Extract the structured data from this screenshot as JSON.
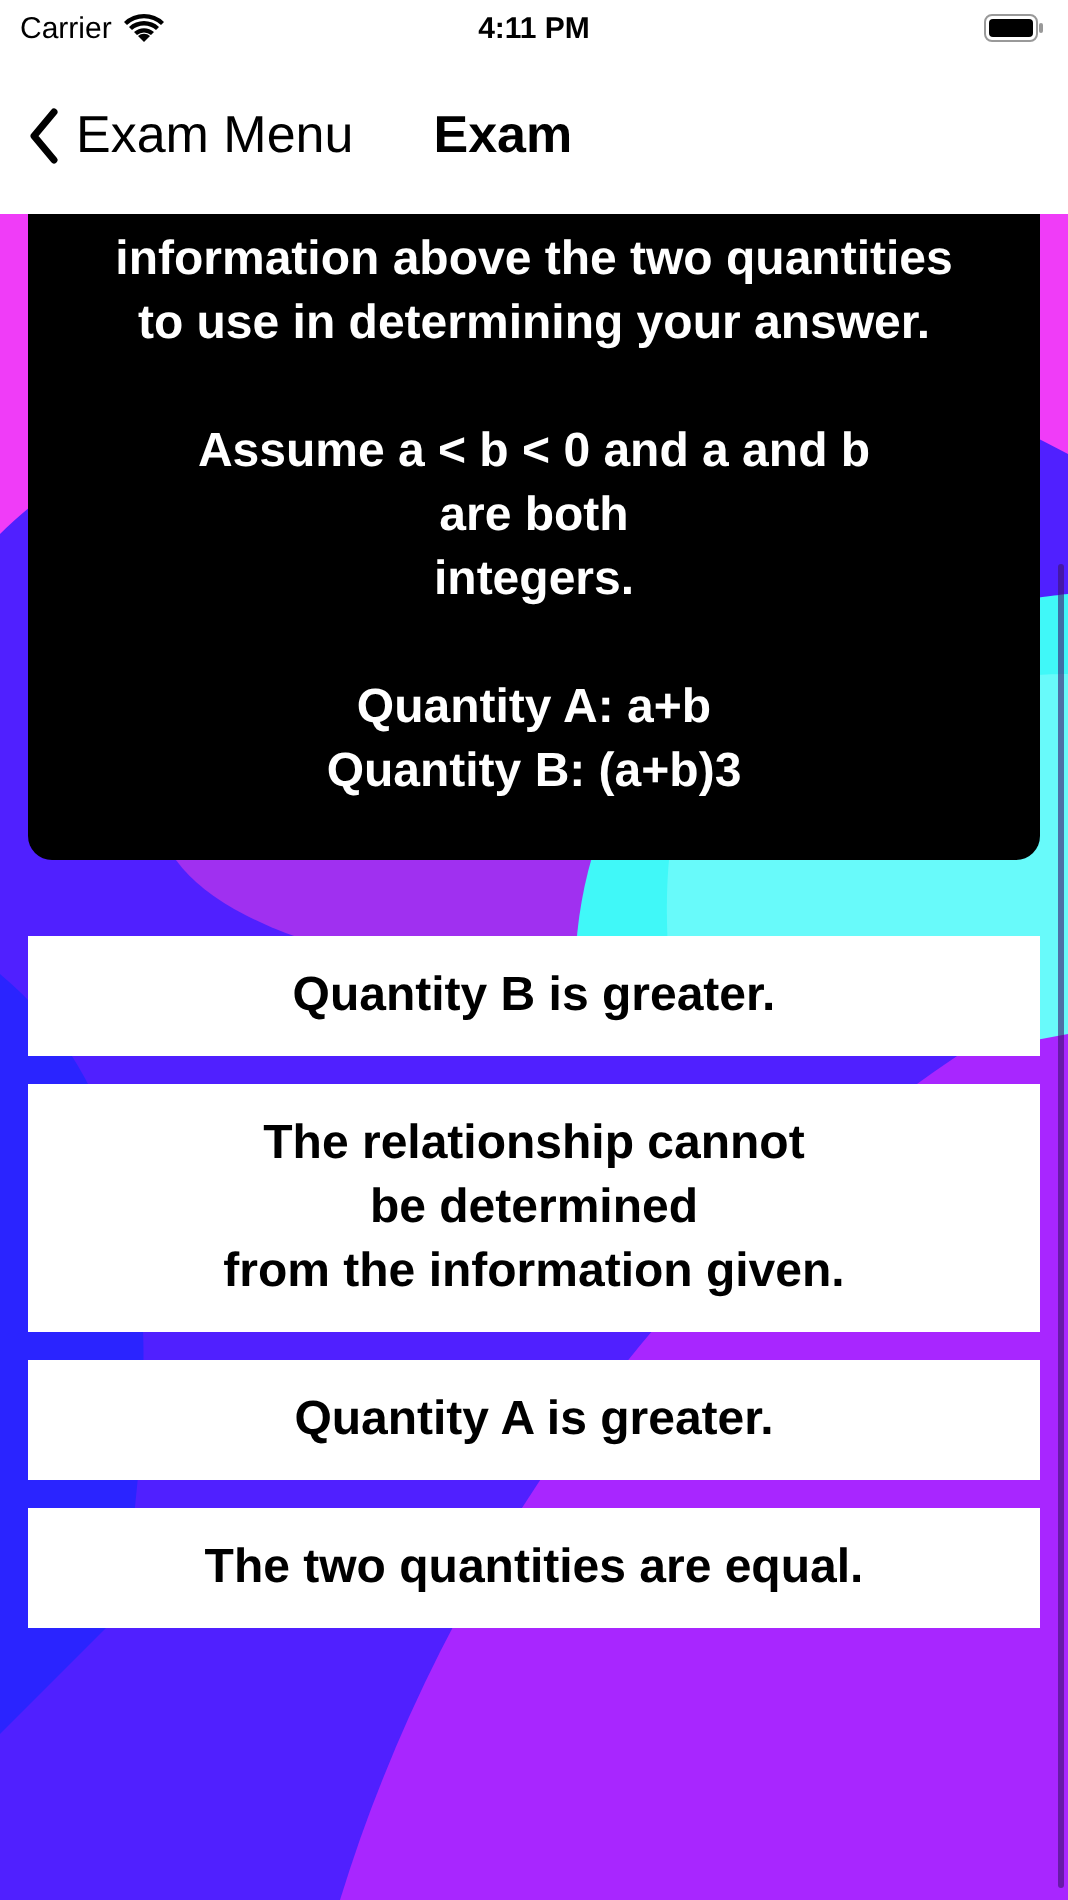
{
  "status_bar": {
    "carrier": "Carrier",
    "time": "4:11 PM"
  },
  "nav_bar": {
    "back_label": "Exam Menu",
    "title": "Exam"
  },
  "question": {
    "paragraphs": [
      [
        "information above the two quantities",
        "to use in determining your answer."
      ],
      [
        "Assume a < b < 0 and a and b",
        "are both",
        "integers."
      ],
      [
        "Quantity A: a+b",
        "Quantity B: (a+b)3"
      ]
    ]
  },
  "answers": [
    {
      "lines": [
        "Quantity B is greater."
      ]
    },
    {
      "lines": [
        "The relationship cannot",
        "be determined",
        "from the information given."
      ]
    },
    {
      "lines": [
        "Quantity A is greater."
      ]
    },
    {
      "lines": [
        "The two quantities are equal."
      ]
    }
  ]
}
